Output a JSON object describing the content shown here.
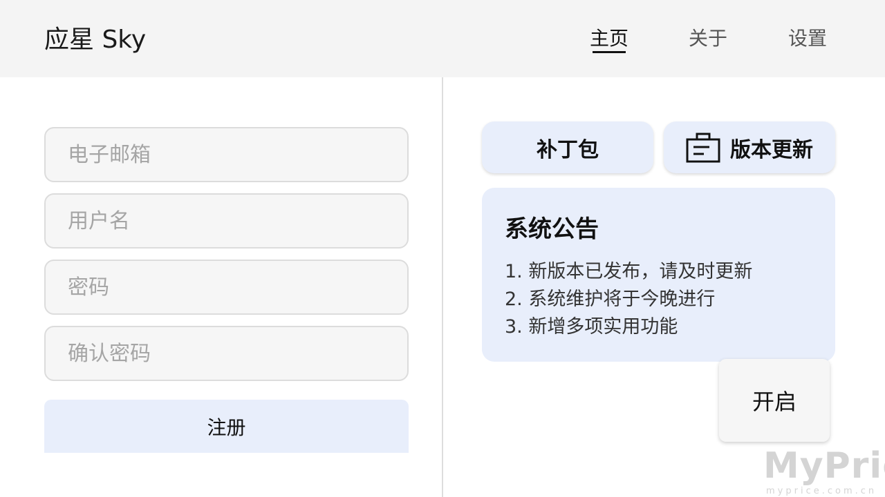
{
  "header": {
    "title": "应星 Sky",
    "nav": [
      {
        "label": "主页",
        "active": true
      },
      {
        "label": "关于",
        "active": false
      },
      {
        "label": "设置",
        "active": false
      }
    ]
  },
  "register_form": {
    "email_placeholder": "电子邮箱",
    "username_placeholder": "用户名",
    "password_placeholder": "密码",
    "confirm_password_placeholder": "确认密码",
    "submit_label": "注册"
  },
  "actions": {
    "patch_label": "补丁包",
    "update_label": "版本更新",
    "update_icon": "notice-board-icon"
  },
  "announcement": {
    "title": "系统公告",
    "items": [
      "1. 新版本已发布，请及时更新",
      "2. 系统维护将于今晚进行",
      "3. 新增多项实用功能"
    ]
  },
  "open_button_label": "开启",
  "watermark": {
    "brand": "MyPrice",
    "url": "myprice.com.cn"
  },
  "colors": {
    "header_bg": "#f4f4f4",
    "accent_bg": "#e8eefb",
    "field_bg": "#f6f6f6",
    "placeholder": "#a5a5a5"
  }
}
